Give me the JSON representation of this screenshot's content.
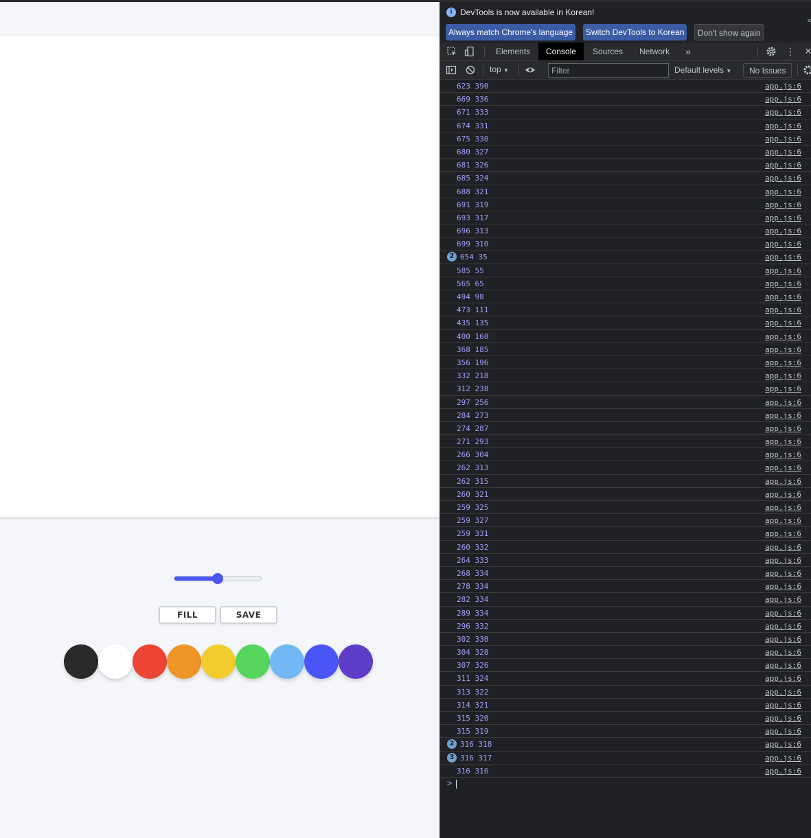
{
  "app": {
    "brush_size_percent": 50,
    "buttons": {
      "fill": "FILL",
      "save": "SAVE"
    },
    "palette": [
      "#2a2a2a",
      "#ffffff",
      "#ee4433",
      "#ef9427",
      "#f2cd2f",
      "#57d65d",
      "#72b8f5",
      "#4a55f8",
      "#5e3dc9"
    ]
  },
  "devtools": {
    "infobar": {
      "icon": "info-icon",
      "message": "DevTools is now available in Korean!",
      "btn_match": "Always match Chrome's language",
      "btn_switch": "Switch DevTools to Korean",
      "btn_dont": "Don't show again"
    },
    "tabs": [
      "Elements",
      "Console",
      "Sources",
      "Network"
    ],
    "active_tab": "Console",
    "toolbar": {
      "context": "top",
      "filter_placeholder": "Filter",
      "levels": "Default levels",
      "issues": "No Issues"
    },
    "logs": [
      {
        "msg": "623 390",
        "src": "app.js:6"
      },
      {
        "msg": "669 336",
        "src": "app.js:6"
      },
      {
        "msg": "671 333",
        "src": "app.js:6"
      },
      {
        "msg": "674 331",
        "src": "app.js:6"
      },
      {
        "msg": "675 330",
        "src": "app.js:6"
      },
      {
        "msg": "680 327",
        "src": "app.js:6"
      },
      {
        "msg": "681 326",
        "src": "app.js:6"
      },
      {
        "msg": "685 324",
        "src": "app.js:6"
      },
      {
        "msg": "688 321",
        "src": "app.js:6"
      },
      {
        "msg": "691 319",
        "src": "app.js:6"
      },
      {
        "msg": "693 317",
        "src": "app.js:6"
      },
      {
        "msg": "696 313",
        "src": "app.js:6"
      },
      {
        "msg": "699 310",
        "src": "app.js:6"
      },
      {
        "msg": "654 35",
        "src": "app.js:6",
        "count": "2"
      },
      {
        "msg": "585 55",
        "src": "app.js:6"
      },
      {
        "msg": "565 65",
        "src": "app.js:6"
      },
      {
        "msg": "494 98",
        "src": "app.js:6"
      },
      {
        "msg": "473 111",
        "src": "app.js:6"
      },
      {
        "msg": "435 135",
        "src": "app.js:6"
      },
      {
        "msg": "400 160",
        "src": "app.js:6"
      },
      {
        "msg": "368 185",
        "src": "app.js:6"
      },
      {
        "msg": "356 196",
        "src": "app.js:6"
      },
      {
        "msg": "332 218",
        "src": "app.js:6"
      },
      {
        "msg": "312 238",
        "src": "app.js:6"
      },
      {
        "msg": "297 256",
        "src": "app.js:6"
      },
      {
        "msg": "284 273",
        "src": "app.js:6"
      },
      {
        "msg": "274 287",
        "src": "app.js:6"
      },
      {
        "msg": "271 293",
        "src": "app.js:6"
      },
      {
        "msg": "266 304",
        "src": "app.js:6"
      },
      {
        "msg": "262 313",
        "src": "app.js:6"
      },
      {
        "msg": "262 315",
        "src": "app.js:6"
      },
      {
        "msg": "260 321",
        "src": "app.js:6"
      },
      {
        "msg": "259 325",
        "src": "app.js:6"
      },
      {
        "msg": "259 327",
        "src": "app.js:6"
      },
      {
        "msg": "259 331",
        "src": "app.js:6"
      },
      {
        "msg": "260 332",
        "src": "app.js:6"
      },
      {
        "msg": "264 333",
        "src": "app.js:6"
      },
      {
        "msg": "268 334",
        "src": "app.js:6"
      },
      {
        "msg": "278 334",
        "src": "app.js:6"
      },
      {
        "msg": "282 334",
        "src": "app.js:6"
      },
      {
        "msg": "289 334",
        "src": "app.js:6"
      },
      {
        "msg": "296 332",
        "src": "app.js:6"
      },
      {
        "msg": "302 330",
        "src": "app.js:6"
      },
      {
        "msg": "304 328",
        "src": "app.js:6"
      },
      {
        "msg": "307 326",
        "src": "app.js:6"
      },
      {
        "msg": "311 324",
        "src": "app.js:6"
      },
      {
        "msg": "313 322",
        "src": "app.js:6"
      },
      {
        "msg": "314 321",
        "src": "app.js:6"
      },
      {
        "msg": "315 320",
        "src": "app.js:6"
      },
      {
        "msg": "315 319",
        "src": "app.js:6"
      },
      {
        "msg": "316 318",
        "src": "app.js:6",
        "count": "2"
      },
      {
        "msg": "316 317",
        "src": "app.js:6",
        "count": "3"
      },
      {
        "msg": "316 316",
        "src": "app.js:6"
      }
    ],
    "prompt": ">"
  }
}
